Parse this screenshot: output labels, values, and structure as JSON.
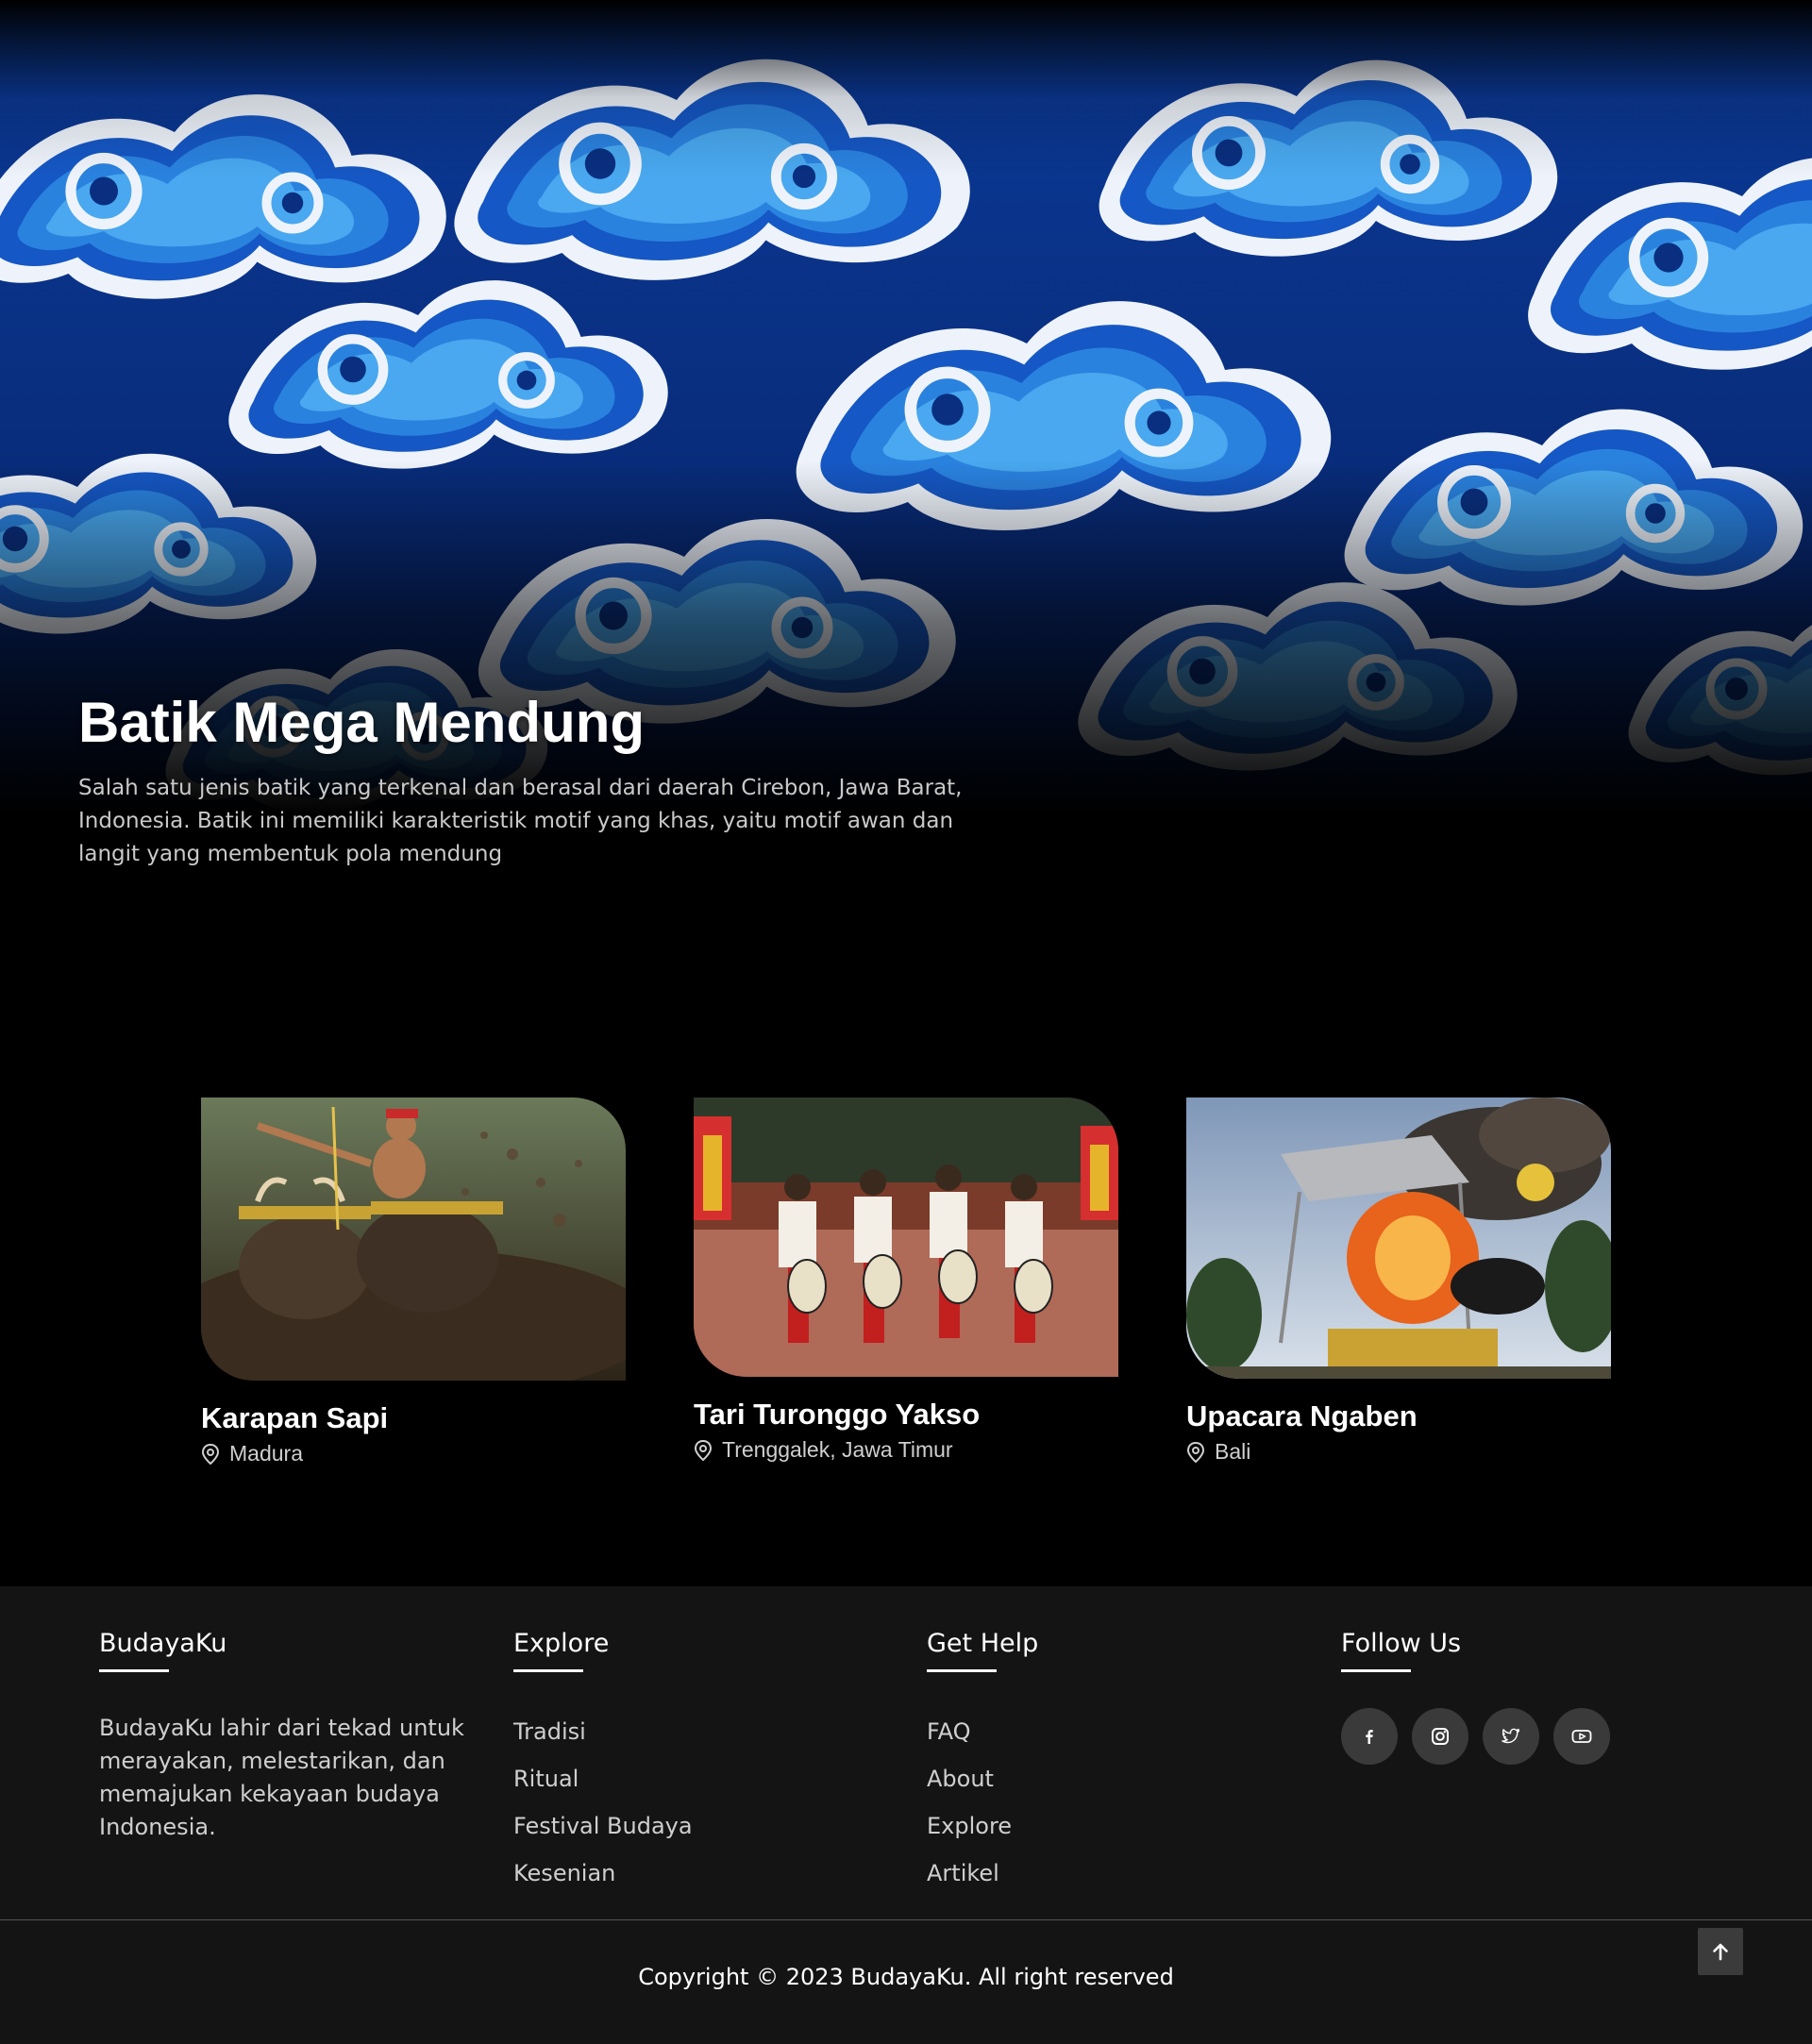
{
  "hero": {
    "title": "Batik Mega Mendung",
    "description": "Salah satu jenis batik yang terkenal dan berasal dari daerah Cirebon, Jawa Barat, Indonesia. Batik ini memiliki karakteristik motif yang khas, yaitu motif awan dan langit yang membentuk pola mendung"
  },
  "cards": [
    {
      "title": "Karapan Sapi",
      "location": "Madura"
    },
    {
      "title": "Tari Turonggo Yakso",
      "location": "Trenggalek, Jawa Timur"
    },
    {
      "title": "Upacara Ngaben",
      "location": "Bali"
    }
  ],
  "footer": {
    "brand": {
      "heading": "BudayaKu",
      "about": "BudayaKu lahir dari tekad untuk merayakan, melestarikan, dan memajukan kekayaan budaya Indonesia."
    },
    "explore": {
      "heading": "Explore",
      "links": [
        "Tradisi",
        "Ritual",
        "Festival Budaya",
        "Kesenian"
      ]
    },
    "help": {
      "heading": "Get Help",
      "links": [
        "FAQ",
        "About",
        "Explore",
        "Artikel"
      ]
    },
    "follow": {
      "heading": "Follow Us",
      "icons": [
        "facebook-icon",
        "instagram-icon",
        "twitter-icon",
        "youtube-icon"
      ]
    },
    "copyright": "Copyright © 2023 BudayaKu. All right reserved"
  },
  "colors": {
    "background": "#000000",
    "footer_bg": "#141414",
    "batik_dark": "#0a2f80",
    "batik_mid": "#1f6fd1",
    "batik_light": "#4fb3f0",
    "social_bg": "#3a3a3a"
  }
}
